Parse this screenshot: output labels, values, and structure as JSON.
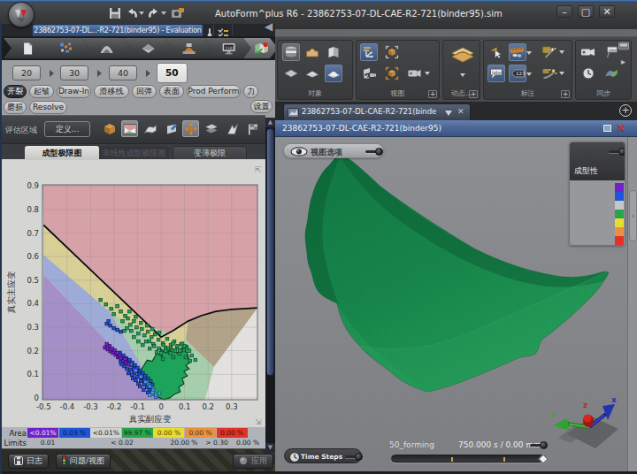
{
  "titlebar": {
    "title": "AutoForm^plus R6 - 23862753-07-DL-CAE-R2-721(binder95).sim",
    "minimize_glyph": "–",
    "maximize_glyph": "▢",
    "close_glyph": "✕"
  },
  "session_tab": {
    "label": "23862753-07-DL...-R2-721(binder95) - Evaluation"
  },
  "nav_steps": [
    "input",
    "blank",
    "die",
    "sheet",
    "forming",
    "simulation",
    "evaluation"
  ],
  "steps": {
    "items": [
      "20",
      "30",
      "40",
      "50"
    ],
    "selected": "50"
  },
  "result_pills_row1": [
    "开裂",
    "起皱",
    "Draw-In",
    "滑移线",
    "回弹",
    "表面",
    "Prod Perform",
    "力"
  ],
  "result_pills_selected": "开裂",
  "result_pills_row2": [
    "磨损",
    "Resolve"
  ],
  "settings_button": "设置",
  "eval_area": {
    "label": "评估区域",
    "define_button": "定义..."
  },
  "fld_tabs": {
    "items": [
      "成型极限图",
      "非线性成型极限图",
      "变薄极限"
    ],
    "selected": "成型极限图",
    "disabled": "非线性成型极限图"
  },
  "chart_data": {
    "type": "scatter",
    "title": "成型极限图",
    "xlabel": "真实副应变",
    "ylabel": "真实主应变",
    "xlim": [
      -0.505,
      0.41
    ],
    "ylim": [
      -0.008,
      0.905
    ],
    "xticks": [
      -0.5,
      -0.4,
      -0.3,
      -0.2,
      -0.1,
      0,
      0.1,
      0.2,
      0.3
    ],
    "yticks": [
      0,
      0.1,
      0.2,
      0.3,
      0.4,
      0.5,
      0.6,
      0.7,
      0.8,
      0.9
    ],
    "grid": true,
    "flc_curve": [
      [
        -0.5,
        0.734
      ],
      [
        -0.25,
        0.496
      ],
      [
        0,
        0.258
      ],
      [
        0.05,
        0.285
      ],
      [
        0.115,
        0.326
      ],
      [
        0.17,
        0.349
      ],
      [
        0.233,
        0.367
      ],
      [
        0.3,
        0.376
      ],
      [
        0.41,
        0.382
      ]
    ],
    "zones": [
      {
        "name": "cracks",
        "color": "#d6a2a8",
        "polygon": [
          [
            -0.505,
            0.905
          ],
          [
            0.41,
            0.905
          ],
          [
            0.41,
            0.382
          ],
          [
            0.3,
            0.376
          ],
          [
            0.233,
            0.367
          ],
          [
            0.17,
            0.349
          ],
          [
            0.115,
            0.326
          ],
          [
            0.05,
            0.285
          ],
          [
            0,
            0.258
          ],
          [
            -0.25,
            0.496
          ],
          [
            -0.5,
            0.734
          ],
          [
            -0.505,
            0.905
          ]
        ]
      },
      {
        "name": "safe",
        "color": "#a7ceac",
        "polygon": [
          [
            -0.22,
            0.367
          ],
          [
            0.104,
            0.247
          ],
          [
            0.224,
            0.131
          ],
          [
            0.187,
            -0.008
          ],
          [
            0.02,
            -0.008
          ],
          [
            0,
            0
          ]
        ]
      },
      {
        "name": "risk-of-cracks",
        "color": "#d8cf96",
        "polygon": [
          [
            -0.5,
            0.734
          ],
          [
            -0.25,
            0.496
          ],
          [
            0,
            0.258
          ],
          [
            0.05,
            0.285
          ],
          [
            0.115,
            0.326
          ],
          [
            0.104,
            0.247
          ],
          [
            0.056,
            0.187
          ],
          [
            -0.22,
            0.367
          ],
          [
            -0.5,
            0.607
          ]
        ]
      },
      {
        "name": "tendency-wrinkles",
        "color": "#9dabd6",
        "polygon": [
          [
            -0.5,
            0.607
          ],
          [
            -0.22,
            0.367
          ],
          [
            0,
            0
          ],
          [
            -0.5,
            0.524
          ]
        ]
      },
      {
        "name": "wrinkles",
        "color": "#a58fc7",
        "polygon": [
          [
            -0.5,
            0.524
          ],
          [
            0,
            0
          ],
          [
            0.02,
            -0.008
          ],
          [
            -0.505,
            -0.008
          ]
        ]
      },
      {
        "name": "thinning",
        "color": "#b2a288",
        "polygon": [
          [
            0.104,
            0.247
          ],
          [
            0.224,
            0.131
          ],
          [
            0.41,
            0.382
          ],
          [
            0.3,
            0.376
          ],
          [
            0.233,
            0.367
          ],
          [
            0.17,
            0.349
          ],
          [
            0.115,
            0.326
          ]
        ]
      }
    ],
    "series": [
      {
        "name": "safe",
        "color": "#1ea35a",
        "outline": "#0a4526",
        "points": [
          [
            -0.2575,
            0.4157
          ],
          [
            -0.2351,
            0.397
          ],
          [
            -0.2127,
            0.3783
          ],
          [
            -0.1866,
            0.3895
          ],
          [
            -0.2015,
            0.3558
          ],
          [
            -0.1716,
            0.367
          ],
          [
            -0.153,
            0.3483
          ],
          [
            -0.1642,
            0.3258
          ],
          [
            -0.1418,
            0.3371
          ],
          [
            -0.1306,
            0.3109
          ],
          [
            -0.1157,
            0.3258
          ],
          [
            -0.1045,
            0.2996
          ],
          [
            -0.1269,
            0.2846
          ],
          [
            -0.097,
            0.2734
          ],
          [
            -0.0821,
            0.2921
          ],
          [
            -0.0709,
            0.2659
          ],
          [
            -0.056,
            0.2809
          ],
          [
            -0.041,
            0.2584
          ],
          [
            -0.0261,
            0.2697
          ],
          [
            -0.0634,
            0.2397
          ],
          [
            -0.0336,
            0.2285
          ],
          [
            -0.0112,
            0.2472
          ],
          [
            0.0075,
            0.2322
          ],
          [
            0.0261,
            0.2509
          ],
          [
            0.041,
            0.2247
          ],
          [
            0.056,
            0.2397
          ],
          [
            0.0672,
            0.2135
          ],
          [
            0.0858,
            0.2285
          ],
          [
            0.097,
            0.2022
          ],
          [
            0.1082,
            0.2172
          ],
          [
            0.0784,
            0.1873
          ],
          [
            0.0522,
            0.1723
          ],
          [
            0.1045,
            0.1723
          ],
          [
            0.1231,
            0.1573
          ],
          [
            0.0075,
            0.1648
          ],
          [
            -0.0187,
            0.1948
          ],
          [
            -0.0485,
            0.2097
          ],
          [
            -0.0784,
            0.2247
          ],
          [
            -0.097,
            0.2397
          ],
          [
            -0.1157,
            0.2584
          ],
          [
            -0.1455,
            0.2959
          ],
          [
            -0.1567,
            0.2846
          ],
          [
            -0.1343,
            0.367
          ],
          [
            -0.1082,
            0.3446
          ],
          [
            -0.0858,
            0.3184
          ],
          [
            -0.0597,
            0.3071
          ],
          [
            -0.0373,
            0.2921
          ],
          [
            -0.0075,
            0.2772
          ],
          [
            0.0187,
            0.2135
          ],
          [
            0.0373,
            0.1948
          ],
          [
            0.1306,
            0.1798
          ],
          [
            0.1455,
            0.161
          ],
          [
            -0.01,
            0.21
          ],
          [
            0.01,
            0.225
          ],
          [
            0.03,
            0.21
          ],
          [
            0.05,
            0.23
          ],
          [
            0.07,
            0.22
          ],
          [
            0.09,
            0.23
          ],
          [
            0.0,
            0.19
          ],
          [
            0.02,
            0.2
          ],
          [
            0.04,
            0.19
          ],
          [
            0.06,
            0.2
          ],
          [
            0.08,
            0.2
          ],
          [
            0.1,
            0.22
          ],
          [
            -0.03,
            0.22
          ],
          [
            -0.05,
            0.24
          ],
          [
            0.11,
            0.21
          ],
          [
            0.12,
            0.2
          ]
        ]
      },
      {
        "name": "tendency-wrinkles",
        "color": "#1c50d8",
        "outline": "#0a1b52",
        "points": [
          [
            -0.2313,
            0.3146
          ],
          [
            -0.2164,
            0.3071
          ],
          [
            -0.2015,
            0.2959
          ],
          [
            -0.1866,
            0.2884
          ],
          [
            -0.1716,
            0.2809
          ],
          [
            -0.2239,
            0.3258
          ],
          [
            -0.1754,
            0.191
          ],
          [
            -0.1604,
            0.1798
          ],
          [
            -0.1493,
            0.1685
          ],
          [
            -0.1343,
            0.161
          ],
          [
            -0.1231,
            0.1498
          ],
          [
            -0.1119,
            0.1386
          ],
          [
            -0.1007,
            0.1273
          ],
          [
            -0.0896,
            0.1161
          ],
          [
            -0.0784,
            0.1049
          ],
          [
            -0.0672,
            0.0936
          ],
          [
            -0.056,
            0.0824
          ],
          [
            -0.0448,
            0.0712
          ],
          [
            -0.0373,
            0.0562
          ],
          [
            -0.1418,
            0.1498
          ],
          [
            -0.1269,
            0.1386
          ],
          [
            -0.1157,
            0.1236
          ],
          [
            -0.1045,
            0.1124
          ],
          [
            -0.0933,
            0.1011
          ],
          [
            -0.0821,
            0.0861
          ],
          [
            -0.0709,
            0.0749
          ],
          [
            -0.1642,
            0.1648
          ],
          [
            -0.153,
            0.1536
          ],
          [
            -0.1306,
            0.1199
          ],
          [
            -0.1157,
            0.1049
          ],
          [
            -0.1007,
            0.0899
          ],
          [
            -0.0858,
            0.0712
          ],
          [
            -0.0709,
            0.0562
          ],
          [
            -0.0597,
            0.0449
          ],
          [
            -0.0485,
            0.0337
          ],
          [
            -0.097,
            0.0599
          ],
          [
            -0.1194,
            0.0824
          ],
          [
            -0.1381,
            0.1049
          ],
          [
            -0.1567,
            0.1348
          ],
          [
            -0.1716,
            0.1536
          ],
          [
            -0.1828,
            0.1723
          ],
          [
            -0.1679,
            0.1423
          ],
          [
            -0.1455,
            0.1236
          ],
          [
            -0.1231,
            0.0974
          ],
          [
            -0.1082,
            0.0749
          ],
          [
            -0.0896,
            0.0487
          ],
          [
            -0.0746,
            0.0337
          ],
          [
            -0.056,
            0.0225
          ]
        ]
      },
      {
        "name": "tendency-light",
        "color": "#5e8ef2",
        "outline": "#1b3a8a",
        "points": [
          [
            -0.1306,
            0.1423
          ],
          [
            -0.1082,
            0.1161
          ],
          [
            -0.0858,
            0.0899
          ],
          [
            -0.0672,
            0.0674
          ],
          [
            -0.0485,
            0.0487
          ],
          [
            -0.0336,
            0.0337
          ],
          [
            -0.041,
            0.015
          ],
          [
            -0.0224,
            0.0037
          ]
        ]
      },
      {
        "name": "wrinkles",
        "color": "#7a1fd8",
        "outline": "#2d0a52",
        "points": [
          [
            -0.2388,
            0.2135
          ],
          [
            -0.2276,
            0.206
          ],
          [
            -0.2164,
            0.1985
          ],
          [
            -0.2052,
            0.191
          ],
          [
            -0.194,
            0.1835
          ],
          [
            -0.1828,
            0.176
          ],
          [
            -0.1716,
            0.1685
          ],
          [
            -0.1604,
            0.1573
          ],
          [
            -0.1493,
            0.1498
          ],
          [
            -0.1381,
            0.1423
          ],
          [
            -0.2201,
            0.221
          ],
          [
            -0.1978,
            0.2022
          ],
          [
            -0.1754,
            0.1835
          ],
          [
            -0.153,
            0.1648
          ],
          [
            -0.2313,
            0.2285
          ],
          [
            -0.209,
            0.2097
          ],
          [
            -0.1866,
            0.191
          ]
        ]
      },
      {
        "name": "insufficient",
        "color": "#3fa8e8",
        "outline": "#14527a",
        "points": [
          [
            -0.0373,
            0.0225
          ],
          [
            -0.0224,
            0.0112
          ],
          [
            -0.0075,
            0.0187
          ],
          [
            -0.0485,
            0.0112
          ]
        ]
      }
    ],
    "dense_cluster_outline": [
      [
        -0.0821,
        0.1236
      ],
      [
        -0.0597,
        0.16
      ],
      [
        -0.0373,
        0.155
      ],
      [
        -0.0187,
        0.19
      ],
      [
        0.0037,
        0.175
      ],
      [
        -0.0037,
        0.21
      ],
      [
        0.0224,
        0.19
      ],
      [
        0.0448,
        0.215
      ],
      [
        0.0672,
        0.19
      ],
      [
        0.0896,
        0.215
      ],
      [
        0.1119,
        0.19
      ],
      [
        0.1231,
        0.1498
      ],
      [
        0.1045,
        0.1386
      ],
      [
        0.1194,
        0.1236
      ],
      [
        0.097,
        0.1124
      ],
      [
        0.1119,
        0.0936
      ],
      [
        0.0896,
        0.0824
      ],
      [
        0.097,
        0.0599
      ],
      [
        0.0746,
        0.0449
      ],
      [
        0.0821,
        0.0262
      ],
      [
        0.056,
        0.015
      ],
      [
        0.0373,
        0
      ],
      [
        0.0112,
        -0.0075
      ],
      [
        -0.0149,
        0.0037
      ],
      [
        -0.0373,
        0.0187
      ],
      [
        -0.056,
        0.0375
      ],
      [
        -0.0746,
        0.0599
      ],
      [
        -0.0896,
        0.0824
      ],
      [
        -0.097,
        0.1049
      ]
    ]
  },
  "area_table": {
    "row1_label": "Area",
    "row2_label": "Limits",
    "cells": [
      {
        "color": "#6f22cb",
        "text_color": "#f0eaf8",
        "value": "<0.01%"
      },
      {
        "color": "#1f55d8",
        "text_color": "#0b1b3a",
        "value": "0.03 %"
      },
      {
        "color": "#d2d2d0",
        "text_color": "#222",
        "value": "<0.01%"
      },
      {
        "color": "#28a44c",
        "text_color": "#07330f",
        "value": "99.97 %"
      },
      {
        "color": "#e8dc30",
        "text_color": "#4a4206",
        "value": "0.00 %"
      },
      {
        "color": "#e89140",
        "text_color": "#5c2c06",
        "value": "0.00 %"
      },
      {
        "color": "#e03226",
        "text_color": "#4a0b06",
        "value": "0.00 %"
      }
    ],
    "limits": [
      {
        "value": "0.01",
        "x": 52
      },
      {
        "value": "< 0.02",
        "x": 136
      },
      {
        "value": "20.00 %",
        "x": 206
      },
      {
        "value": "> 0.30",
        "x": 243
      },
      {
        "value": "0.00 %",
        "x": 278
      }
    ]
  },
  "bottom_bar": {
    "log": "日志",
    "issues": "问题/视图",
    "apply": "应用"
  },
  "toolbar_groups": [
    {
      "label": "对象"
    },
    {
      "label": "视图"
    },
    {
      "label": "动态..."
    },
    {
      "label": "标注"
    },
    {
      "label": "同步"
    }
  ],
  "doc_tab": {
    "label": "23862753-07-DL-CAE-R2-721(binde",
    "close_glyph": "✕",
    "add_glyph": "+"
  },
  "viewport": {
    "window_title": "23862753-07-DL-CAE-R2-721(binder95)",
    "close_glyph": "✕",
    "view_options": "视图选项",
    "legend_title": "成型性",
    "legend_colors": [
      "#6f22cb",
      "#1f55d8",
      "#c6c6c4",
      "#28a44c",
      "#e8dc30",
      "#e89140",
      "#e03226"
    ],
    "time_steps": "Time Steps",
    "stage": "50_forming",
    "time_readout": "750.000 s / 0.00 mm",
    "axis_x": "x",
    "axis_y": "y",
    "axis_z": "z"
  },
  "glyphs": {
    "splitter": "◀",
    "scroll_up": "▲",
    "scroll_down": "▼",
    "grip_tl": "⇱",
    "grip_br": "⇲",
    "panel_handle": "‹",
    "overflow_next": "▸",
    "monitor_text": "1101",
    "label_tag": "label",
    "number_tag": "123"
  }
}
